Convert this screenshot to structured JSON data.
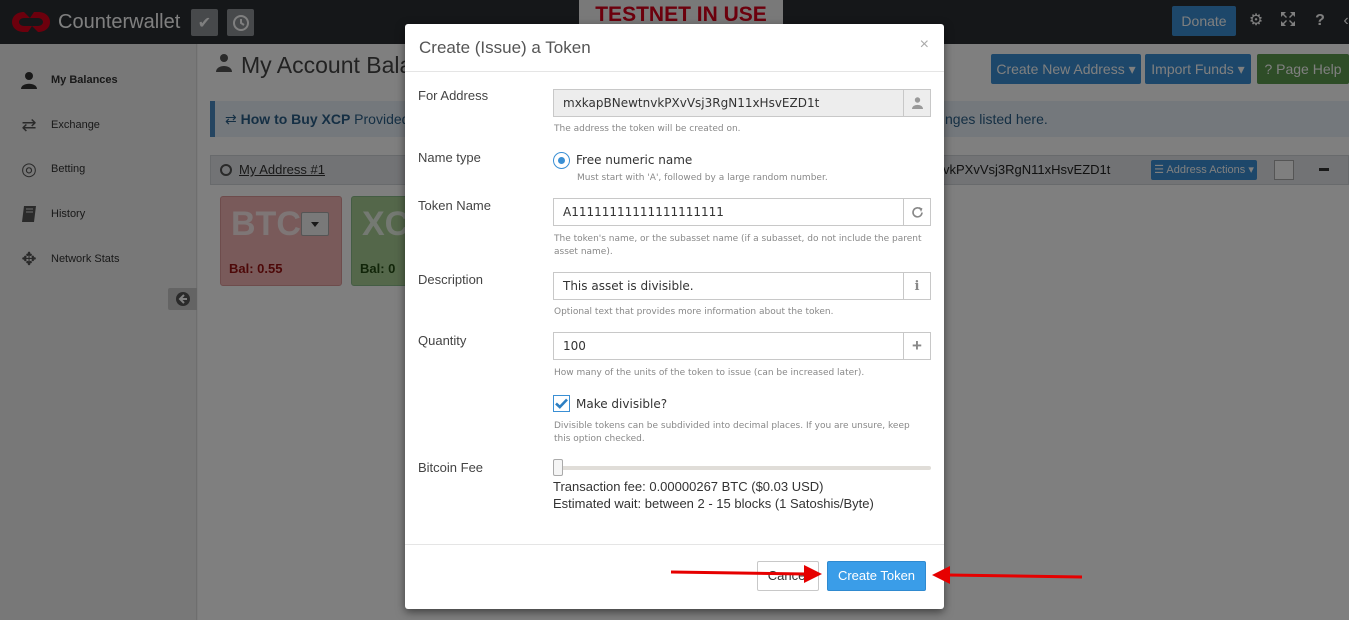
{
  "app": {
    "brand": "Counterwallet",
    "testnet_banner": "TESTNET IN USE",
    "donate_label": "Donate"
  },
  "sidebar": {
    "items": [
      {
        "label": "My Balances",
        "icon": "user-icon"
      },
      {
        "label": "Exchange",
        "icon": "exchange-icon"
      },
      {
        "label": "Betting",
        "icon": "target-icon"
      },
      {
        "label": "History",
        "icon": "book-icon"
      },
      {
        "label": "Network Stats",
        "icon": "crosshair-icon"
      }
    ]
  },
  "main": {
    "title": "My Account Balanc",
    "buttons": {
      "create_address": "Create New Address",
      "import_funds": "Import Funds",
      "page_help": "Page Help"
    },
    "info_bar": {
      "bold": "How to Buy XCP",
      "text": " Provided t",
      "right_text": "nges listed ",
      "link": "here."
    },
    "address": {
      "link": "My Address #1",
      "value_fragment": "vkPXvVsj3RgN11xHsvEZD1t",
      "actions_label": "Address Actions"
    },
    "balances": [
      {
        "code": "BTC",
        "balance": "Bal: 0.55"
      },
      {
        "code": "XC",
        "balance": "Bal: 0"
      }
    ]
  },
  "modal": {
    "title": "Create (Issue) a Token",
    "close": "×",
    "for_address": {
      "label": "For Address",
      "value": "mxkapBNewtnvkPXvVsj3RgN11xHsvEZD1t",
      "help": "The address the token will be created on."
    },
    "name_type": {
      "label": "Name type",
      "option": "Free numeric name",
      "help": "Must start with 'A', followed by a large random number."
    },
    "token_name": {
      "label": "Token Name",
      "value": "A11111111111111111111",
      "help": "The token's name, or the subasset name (if a subasset, do not include the parent asset name)."
    },
    "description": {
      "label": "Description",
      "value": "This asset is divisible.",
      "help": "Optional text that provides more information about the token."
    },
    "quantity": {
      "label": "Quantity",
      "value": "100",
      "help": "How many of the units of the token to issue (can be increased later)."
    },
    "divisible": {
      "label": "Make divisible?",
      "checked": true,
      "help": "Divisible tokens can be subdivided into decimal places. If you are unsure, keep this option checked."
    },
    "bitcoin_fee": {
      "label": "Bitcoin Fee",
      "slider_level": 0,
      "fee_line": "Transaction fee: 0.00000267 BTC ($0.03 USD)",
      "wait_line": "Estimated wait: between 2 - 15 blocks (1 Satoshis/Byte)"
    },
    "footer": {
      "cancel": "Cancel",
      "create": "Create Token"
    }
  },
  "colors": {
    "topbar": "#2a2f33",
    "brand_red": "#d8001b",
    "primary": "#3a8fd4",
    "help_green": "#5c9a4e",
    "arrow_red": "#e60000",
    "btc_card": "#f2b4b4",
    "xcp_card": "#a8cf94"
  }
}
